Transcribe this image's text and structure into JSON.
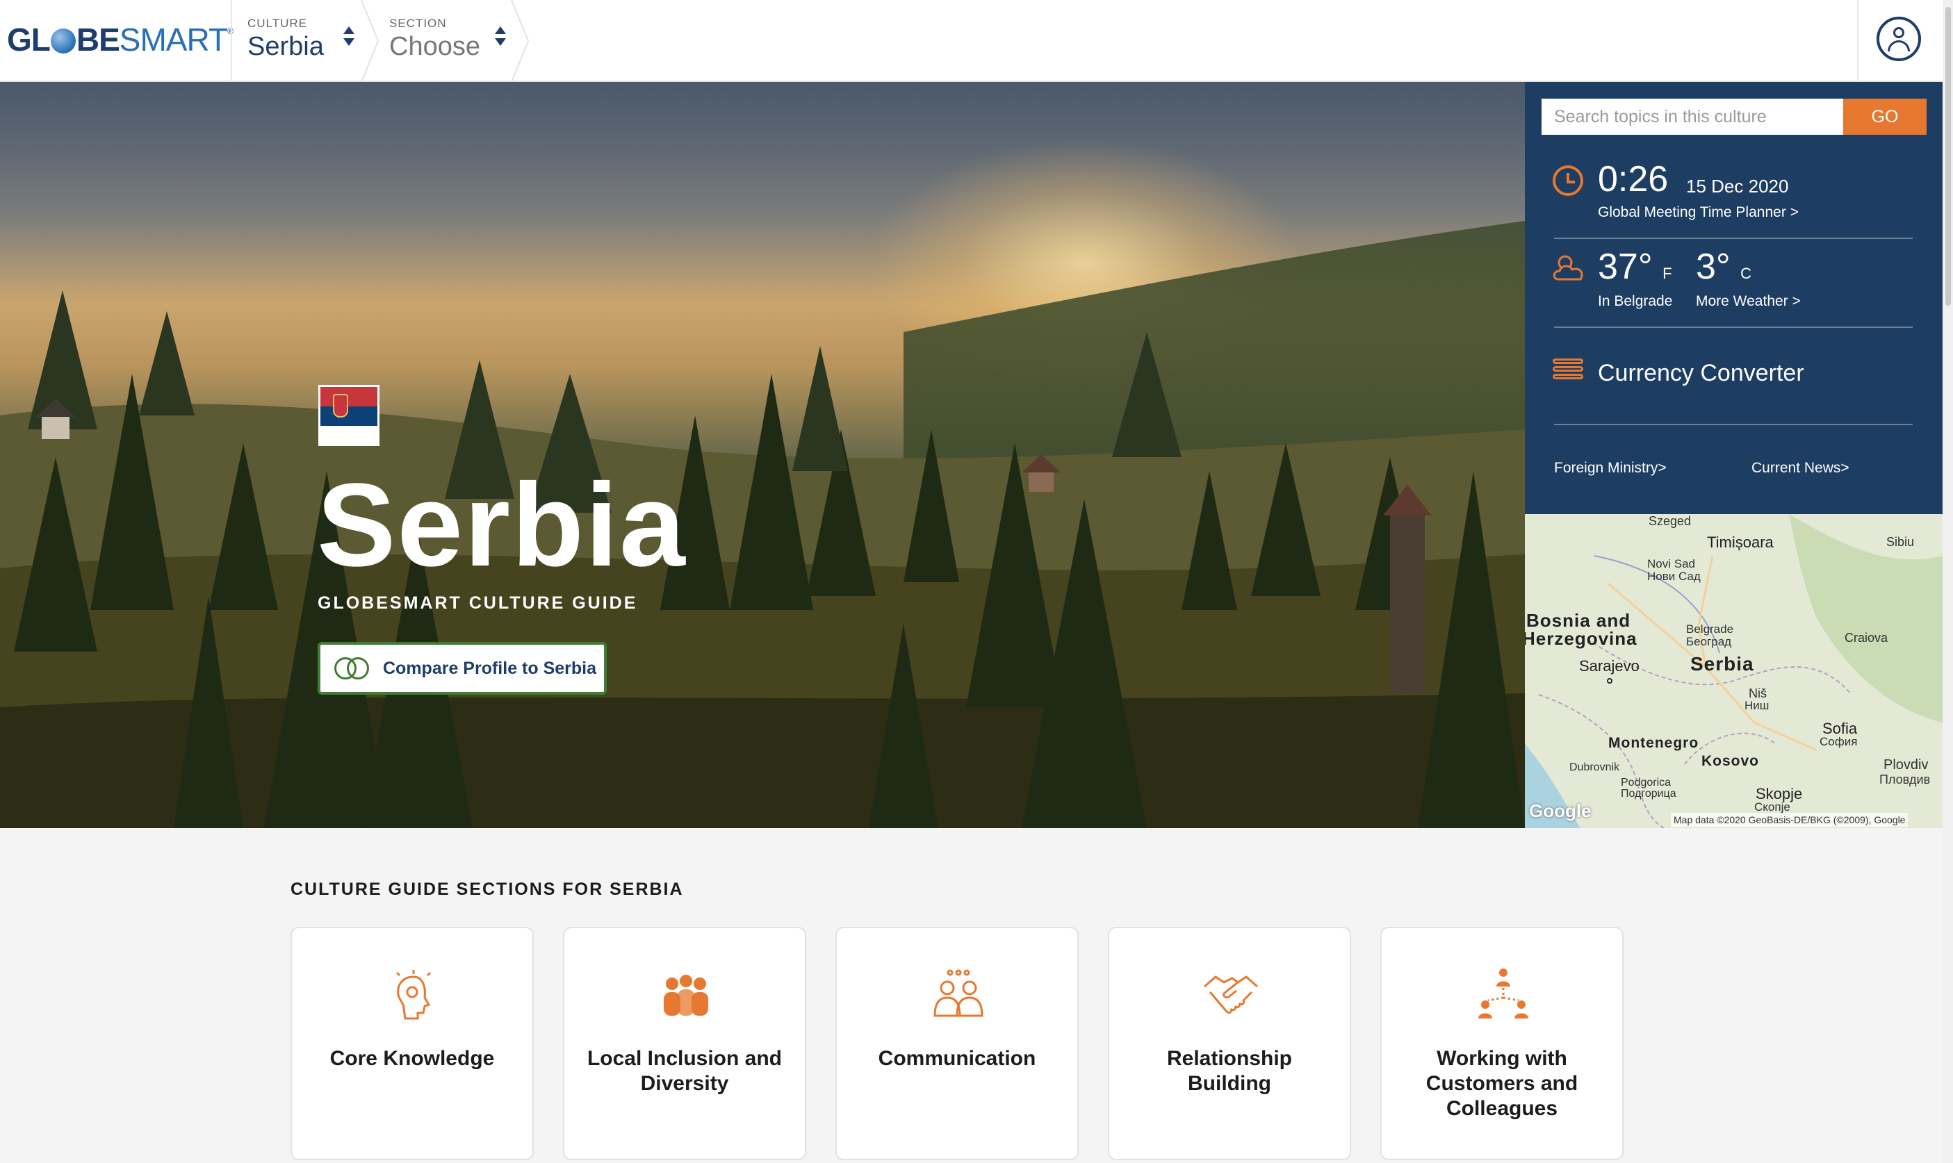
{
  "header": {
    "logo_globe_text": "GL",
    "logo_rest_text": "BE",
    "logo_smart_text": "SMART",
    "culture_caption": "CULTURE",
    "culture_value": "Serbia",
    "section_caption": "SECTION",
    "section_value": "Choose"
  },
  "hero": {
    "country_name": "Serbia",
    "subtitle": "GLOBESMART CULTURE GUIDE",
    "compare_button": "Compare Profile to Serbia"
  },
  "panel": {
    "search_placeholder": "Search topics in this culture",
    "go_button": "GO",
    "time": "0:26",
    "date": "15 Dec 2020",
    "planner_link": "Global Meeting Time Planner >",
    "temp_f": "37°",
    "temp_f_unit": "F",
    "temp_c": "3°",
    "temp_c_unit": "C",
    "weather_location": "In Belgrade",
    "more_weather_link": "More Weather >",
    "currency_converter": "Currency Converter",
    "foreign_ministry_link": "Foreign Ministry>",
    "current_news_link": "Current News>"
  },
  "map": {
    "labels": {
      "szeged": "Szeged",
      "timisoara": "Timișoara",
      "sibiu": "Sibiu",
      "novi_sad": "Novi Sad",
      "novi_sad_cyr": "Нови Сад",
      "bosnia": "Bosnia and",
      "herzegovina": "Herzegovina",
      "belgrade": "Belgrade",
      "belgrade_cyr": "Београд",
      "craiova": "Craiova",
      "sarajevo": "Sarajevo",
      "serbia": "Serbia",
      "nis": "Niš",
      "nis_cyr": "Ниш",
      "sofia": "Sofia",
      "sofia_cyr": "София",
      "montenegro": "Montenegro",
      "kosovo": "Kosovo",
      "dubrovnik": "Dubrovnik",
      "plovdiv": "Plovdiv",
      "plovdiv_cyr": "Пловдив",
      "podgorica": "Podgorica",
      "podgorica_cyr": "Подгорица",
      "skopje": "Skopje",
      "skopje_cyr": "Скопје"
    },
    "google_logo": "Google",
    "credit": "Map data ©2020 GeoBasis-DE/BKG (©2009), Google"
  },
  "sections": {
    "title": "CULTURE GUIDE SECTIONS FOR SERBIA",
    "cards": [
      {
        "label": "Core Knowledge",
        "icon": "head-gears-icon"
      },
      {
        "label": "Local Inclusion and Diversity",
        "icon": "diverse-people-icon"
      },
      {
        "label": "Communication",
        "icon": "people-talking-icon"
      },
      {
        "label": "Relationship Building",
        "icon": "handshake-icon"
      },
      {
        "label": "Working with Customers and Colleagues",
        "icon": "network-people-icon"
      }
    ]
  },
  "colors": {
    "navy": "#1d3d63",
    "accent_orange": "#e7782f",
    "compare_green": "#3e7d33",
    "flag_red": "#c6363c",
    "flag_blue": "#0c4076"
  }
}
